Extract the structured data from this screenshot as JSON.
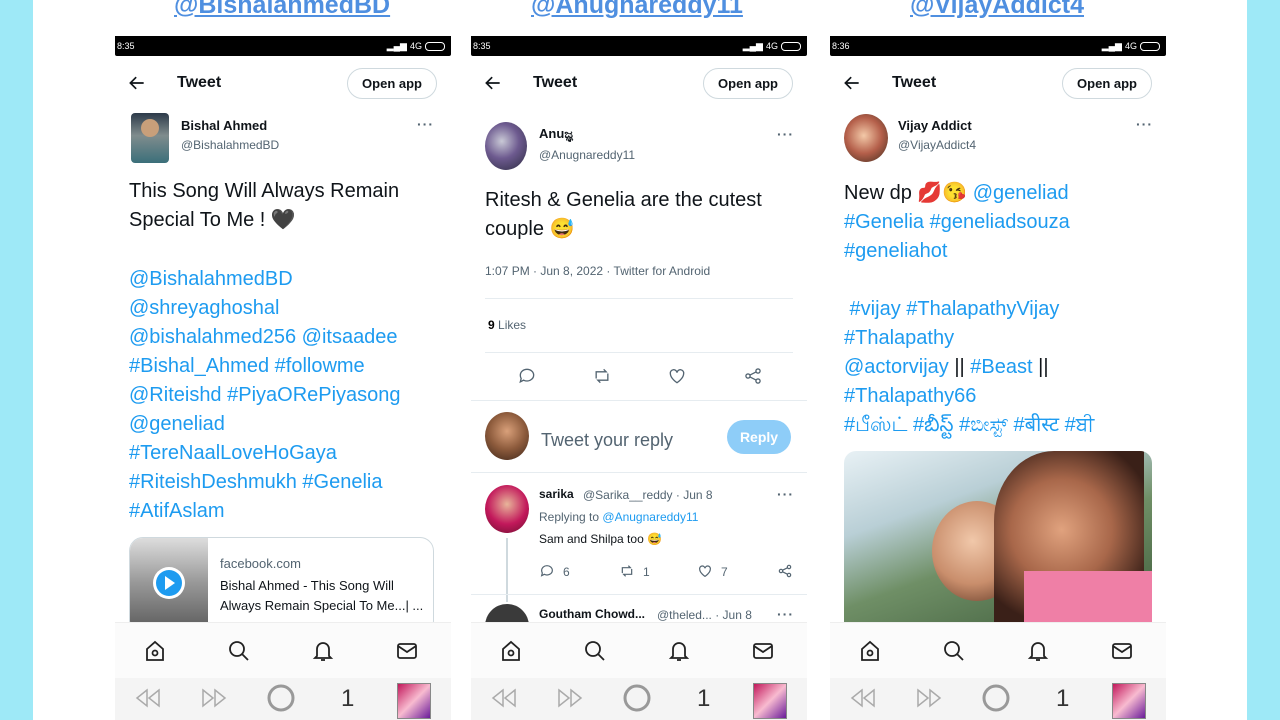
{
  "handles": [
    "@BishalahmedBD",
    "@Anughareddy11",
    "@VijayAddict4"
  ],
  "phones": [
    {
      "status_time": "8:35",
      "status_net": "4G",
      "title": "Tweet",
      "open_app": "Open app",
      "author_name": "Bishal Ahmed",
      "author_handle": "@BishalahmedBD",
      "text_plain": "This Song Will Always Remain Special To Me ! 🖤",
      "text_tags": "@BishalahmedBD\n@shreyaghoshal\n@bishalahmed256 @itsaadee\n#Bishal_Ahmed #followme\n@Riteishd #PiyaORePiyasong\n@geneliad\n#TereNaalLoveHoGaya\n#RiteishDeshmukh #Genelia\n#AtifAslam",
      "card_domain": "facebook.com",
      "card_title": "Bishal Ahmed - This Song Will Always Remain Special To Me...| ...",
      "sys_number": "1"
    },
    {
      "status_time": "8:35",
      "status_net": "4G",
      "title": "Tweet",
      "open_app": "Open app",
      "author_name": "Anuಜ್ಞ",
      "author_handle": "@Anugnareddy11",
      "text_plain": "Ritesh & Genelia are the cutest couple 😅",
      "timestamp": "1:07 PM · Jun 8, 2022 · Twitter for Android",
      "likes_count": "9",
      "likes_label": "Likes",
      "reply_placeholder": "Tweet your reply",
      "reply_button": "Reply",
      "reply1_name": "sarika",
      "reply1_handle": "@Sarika__reddy · Jun 8",
      "reply1_replying_prefix": "Replying to",
      "reply1_replying_to": "@Anugnareddy11",
      "reply1_text": "Sam and Shilpa too 😅",
      "reply1_replies": "6",
      "reply1_retweets": "1",
      "reply1_likes": "7",
      "reply2_name": "Goutham Chowd...",
      "reply2_handle": "@theled... · Jun 8",
      "sys_number": "1"
    },
    {
      "status_time": "8:36",
      "status_net": "4G",
      "title": "Tweet",
      "open_app": "Open app",
      "author_name": "Vijay Addict",
      "author_handle": "@VijayAddict4",
      "text_prefix": "New dp 💋😘 ",
      "text_first_tag": "@geneliad",
      "text_line2": "#Genelia #geneliadsouza\n#geneliahot",
      "text_line3": " #vijay #ThalapathyVijay\n#Thalapathy",
      "text_line4a": "@actorvijay",
      "text_line4b": " || ",
      "text_line4c": "#Beast",
      "text_line4d": " ||",
      "text_line5": "#Thalapathy66\n#பீஸ்ட் #బీస్ట్ #ಬೀಸ್ಟ್ #बीस्ट #ਬੀ",
      "sys_number": "1"
    }
  ],
  "colors": {
    "accent": "#1d9bf0",
    "background": "#9ee9f7",
    "handle": "#4f8fe0"
  }
}
